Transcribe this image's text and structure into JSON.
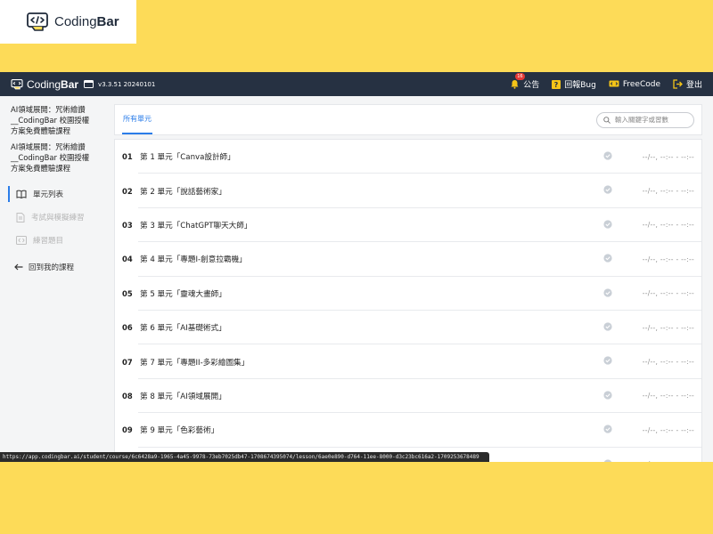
{
  "logo": {
    "prefix": "Coding",
    "suffix": "Bar"
  },
  "topbar": {
    "version": "v3.3.51 20240101",
    "badge_count": "16",
    "announcement": "公告",
    "report_bug": "回報Bug",
    "freecode": "FreeCode",
    "logout": "登出"
  },
  "sidebar": {
    "course_title_1": "AI領域展開：咒術繪讚__CodingBar 校園授權方案免費體驗課程",
    "course_title_2": "AI領域展開：咒術繪讚__CodingBar 校園授權方案免費體驗課程",
    "nav": {
      "units": "單元列表",
      "exams": "考試與模擬練習",
      "practice": "練習題目"
    },
    "back": "回到我的課程"
  },
  "main": {
    "tab_all": "所有單元",
    "search_placeholder": "輸入關鍵字或習數",
    "units": [
      {
        "num": "01",
        "name": "第 1 單元「Canva設計師」",
        "time": "--/--, --:-- - --:--"
      },
      {
        "num": "02",
        "name": "第 2 單元「說話藝術家」",
        "time": "--/--, --:-- - --:--"
      },
      {
        "num": "03",
        "name": "第 3 單元「ChatGPT聊天大師」",
        "time": "--/--, --:-- - --:--"
      },
      {
        "num": "04",
        "name": "第 4 單元「專題I-創意拉霸機」",
        "time": "--/--, --:-- - --:--"
      },
      {
        "num": "05",
        "name": "第 5 單元「靈魂大畫師」",
        "time": "--/--, --:-- - --:--"
      },
      {
        "num": "06",
        "name": "第 6 單元「AI基礎術式」",
        "time": "--/--, --:-- - --:--"
      },
      {
        "num": "07",
        "name": "第 7 單元「專題II-多彩繪圖集」",
        "time": "--/--, --:-- - --:--"
      },
      {
        "num": "08",
        "name": "第 8 單元「AI領域展開」",
        "time": "--/--, --:-- - --:--"
      },
      {
        "num": "09",
        "name": "第 9 單元「色彩藝術」",
        "time": "--/--, --:-- - --:--"
      },
      {
        "num": "",
        "name": "",
        "time": "--/--, --:-- - --:--"
      }
    ]
  },
  "status_url": "https://app.codingbar.ai/student/course/6c6428a9-1965-4a45-9978-73eb7025db47-1708674395074/lesson/6ae0e890-d764-11ee-8000-d3c23bc616a2-1709253678489",
  "colors": {
    "accent": "#2b7de9",
    "topbar": "#263142",
    "background": "#fddb58"
  }
}
